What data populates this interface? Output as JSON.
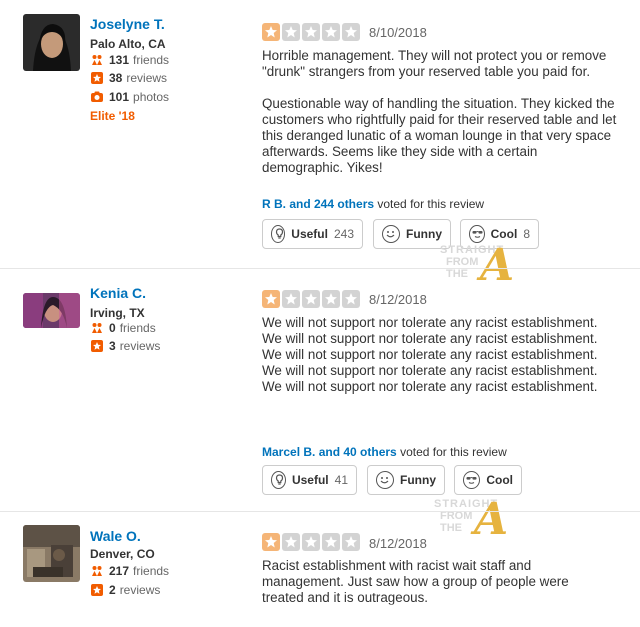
{
  "reviews": [
    {
      "user": {
        "name": "Joselyne T.",
        "location": "Palo Alto, CA",
        "friends_count": "131",
        "friends_label": "friends",
        "reviews_count": "38",
        "reviews_label": "reviews",
        "photos_count": "101",
        "photos_label": "photos",
        "elite": "Elite '18"
      },
      "rating": 1,
      "date": "8/10/2018",
      "paragraphs": [
        "Horrible management. They will not protect you or remove \"drunk\" strangers from your reserved table you paid for.",
        "Questionable way of handling the situation. They kicked the customers who rightfully paid for their reserved table and let this deranged lunatic of a woman lounge in that very space afterwards. Seems like they side with a certain demographic. Yikes!"
      ],
      "voted_who": "R B. and 244 others",
      "voted_text": "voted for this review",
      "buttons": {
        "useful_label": "Useful",
        "useful_count": "243",
        "funny_label": "Funny",
        "funny_count": "",
        "cool_label": "Cool",
        "cool_count": "8"
      }
    },
    {
      "user": {
        "name": "Kenia C.",
        "location": "Irving, TX",
        "friends_count": "0",
        "friends_label": "friends",
        "reviews_count": "3",
        "reviews_label": "reviews"
      },
      "rating": 1,
      "date": "8/12/2018",
      "paragraphs": [
        "We will not support nor tolerate any racist establishment. We will not support nor tolerate any racist establishment. We will not support nor tolerate any racist establishment. We will not support nor tolerate any racist establishment. We will not support nor tolerate any racist establishment."
      ],
      "voted_who": "Marcel B. and 40 others",
      "voted_text": "voted for this review",
      "buttons": {
        "useful_label": "Useful",
        "useful_count": "41",
        "funny_label": "Funny",
        "funny_count": "",
        "cool_label": "Cool",
        "cool_count": ""
      }
    },
    {
      "user": {
        "name": "Wale O.",
        "location": "Denver, CO",
        "friends_count": "217",
        "friends_label": "friends",
        "reviews_count": "2",
        "reviews_label": "reviews"
      },
      "rating": 1,
      "date": "8/12/2018",
      "paragraphs": [
        "Racist establishment with racist wait staff and management. Just saw how a group of people were treated and it is outrageous."
      ]
    }
  ],
  "watermark": {
    "line1": "STRAIGHT",
    "line2": "FROM",
    "line3": "THE",
    "logo_letter": "A"
  },
  "colors": {
    "link_blue": "#0073bb",
    "elite_orange": "#f15c00",
    "star_on": "#f5b577",
    "star_off": "#d3d3d3"
  }
}
